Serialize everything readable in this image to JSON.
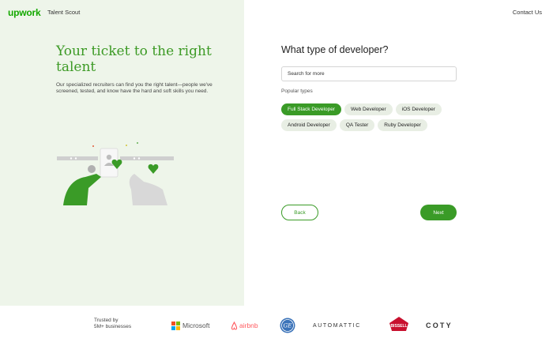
{
  "header": {
    "logo": "upwork",
    "product": "Talent Scout",
    "contact": "Contact Us"
  },
  "hero": {
    "title": "Your ticket to the right talent",
    "text": "Our specialized recruiters can find you the right talent—people we've screened, tested, and know have the hard and soft skills you need."
  },
  "form": {
    "question": "What type of developer?",
    "search_placeholder": "Search for more",
    "popular_label": "Popular types",
    "chips": [
      {
        "label": "Full Stack Developer",
        "selected": true
      },
      {
        "label": "Web Developer",
        "selected": false
      },
      {
        "label": "iOS Developer",
        "selected": false
      },
      {
        "label": "Android Developer",
        "selected": false
      },
      {
        "label": "QA Tester",
        "selected": false
      },
      {
        "label": "Ruby Developer",
        "selected": false
      }
    ],
    "back_label": "Back",
    "next_label": "Next"
  },
  "footer": {
    "trusted_line1": "Trusted by",
    "trusted_line2": "5M+ businesses",
    "brands": [
      "Microsoft",
      "airbnb",
      "GE",
      "AUTOMATTIC",
      "BISSELL",
      "COTY"
    ]
  },
  "colors": {
    "brand_green": "#14a800",
    "button_green": "#3a9b27",
    "left_background": "#eef5ea"
  }
}
